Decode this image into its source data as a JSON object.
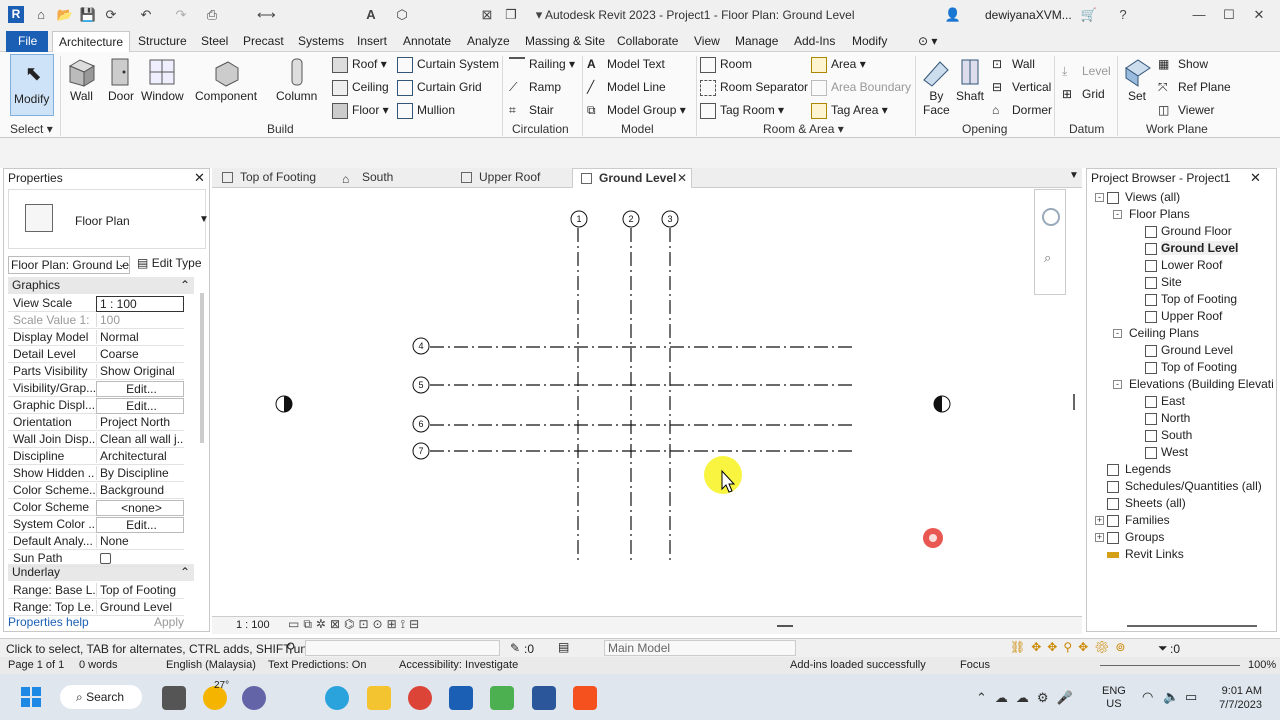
{
  "window": {
    "title": "Autodesk Revit 2023 - Project1 - Floor Plan: Ground Level",
    "user": "dewiyanaXVM..."
  },
  "ribbon_tabs": [
    "File",
    "Architecture",
    "Structure",
    "Steel",
    "Precast",
    "Systems",
    "Insert",
    "Annotate",
    "Analyze",
    "Massing & Site",
    "Collaborate",
    "View",
    "Manage",
    "Add-Ins",
    "Modify"
  ],
  "ribbon": {
    "select": {
      "modify": "Modify",
      "panel": "Select"
    },
    "build": {
      "wall": "Wall",
      "door": "Door",
      "window": "Window",
      "component": "Component",
      "column": "Column",
      "roof": "Roof",
      "ceiling": "Ceiling",
      "floor": "Floor",
      "curtain_system": "Curtain System",
      "curtain_grid": "Curtain Grid",
      "mullion": "Mullion",
      "panel": "Build"
    },
    "circulation": {
      "railing": "Railing",
      "ramp": "Ramp",
      "stair": "Stair",
      "panel": "Circulation"
    },
    "model": {
      "model_text": "Model Text",
      "model_line": "Model Line",
      "model_group": "Model Group",
      "panel": "Model"
    },
    "room_area": {
      "room": "Room",
      "room_separator": "Room Separator",
      "tag_room": "Tag Room",
      "area": "Area",
      "area_boundary": "Area Boundary",
      "tag_area": "Tag Area",
      "panel": "Room & Area"
    },
    "opening": {
      "by_face": "By Face",
      "shaft": "Shaft",
      "wall": "Wall",
      "vertical": "Vertical",
      "dormer": "Dormer",
      "panel": "Opening"
    },
    "datum": {
      "level": "Level",
      "grid": "Grid",
      "panel": "Datum"
    },
    "work_plane": {
      "set": "Set",
      "show": "Show",
      "ref_plane": "Ref Plane",
      "viewer": "Viewer",
      "panel": "Work Plane"
    }
  },
  "properties": {
    "title": "Properties",
    "type": "Floor Plan",
    "instance": "Floor Plan: Ground Le",
    "edit_type": "Edit Type",
    "graphics": "Graphics",
    "underlay": "Underlay",
    "rows": [
      {
        "k": "View Scale",
        "v": "1 : 100"
      },
      {
        "k": "Scale Value    1:",
        "v": "100"
      },
      {
        "k": "Display Model",
        "v": "Normal"
      },
      {
        "k": "Detail Level",
        "v": "Coarse"
      },
      {
        "k": "Parts Visibility",
        "v": "Show Original"
      },
      {
        "k": "Visibility/Grap...",
        "v": "Edit..."
      },
      {
        "k": "Graphic Displ...",
        "v": "Edit..."
      },
      {
        "k": "Orientation",
        "v": "Project North"
      },
      {
        "k": "Wall Join Disp...",
        "v": "Clean all wall j..."
      },
      {
        "k": "Discipline",
        "v": "Architectural"
      },
      {
        "k": "Show Hidden ...",
        "v": "By Discipline"
      },
      {
        "k": "Color Scheme...",
        "v": "Background"
      },
      {
        "k": "Color Scheme",
        "v": "<none>"
      },
      {
        "k": "System Color ...",
        "v": "Edit..."
      },
      {
        "k": "Default Analy...",
        "v": "None"
      },
      {
        "k": "Sun Path",
        "v": ""
      }
    ],
    "underlay_rows": [
      {
        "k": "Range: Base L...",
        "v": "Top of Footing"
      },
      {
        "k": "Range: Top Le...",
        "v": "Ground Level"
      }
    ],
    "help": "Properties help",
    "apply": "Apply"
  },
  "view_tabs": [
    "Top of Footing",
    "South",
    "Upper Roof",
    "Ground Level"
  ],
  "grid_labels": {
    "vertical": [
      "1",
      "2",
      "3"
    ],
    "horizontal": [
      "4",
      "5",
      "6",
      "7"
    ]
  },
  "view_scale": "1 : 100",
  "browser": {
    "title": "Project Browser - Project1",
    "items": [
      "Views (all)",
      "Floor Plans",
      "Ground Floor",
      "Ground Level",
      "Lower Roof",
      "Site",
      "Top of Footing",
      "Upper Roof",
      "Ceiling Plans",
      "Ground Level",
      "Top of Footing",
      "Elevations (Building Elevati",
      "East",
      "North",
      "South",
      "West",
      "Legends",
      "Schedules/Quantities (all)",
      "Sheets (all)",
      "Families",
      "Groups",
      "Revit Links"
    ]
  },
  "status": {
    "hint": "Click to select, TAB for alternates, CTRL adds, SHIFT unse",
    "zero": ":0",
    "model": "Main Model",
    "filter": ":0"
  },
  "word": {
    "page": "Page 1 of 1",
    "words": "0 words",
    "lang": "English (Malaysia)",
    "pred": "Text Predictions: On",
    "access": "Accessibility: Investigate",
    "addins": "Add-ins loaded successfully",
    "focus": "Focus",
    "zoom": "100%"
  },
  "taskbar": {
    "search": "Search",
    "temp": "27°",
    "lang1": "ENG",
    "lang2": "US",
    "time": "9:01 AM",
    "date": "7/7/2023"
  }
}
